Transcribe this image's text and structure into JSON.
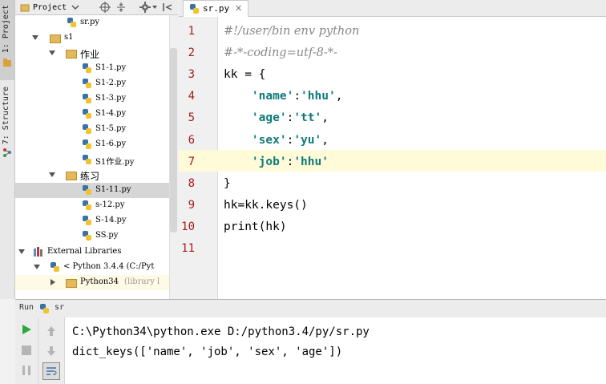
{
  "side_tabs": {
    "project": "1: Project",
    "structure": "7: Structure"
  },
  "project_panel": {
    "title": "Project"
  },
  "tree": [
    {
      "label": "sr.py",
      "type": "py"
    },
    {
      "label": "s1",
      "type": "folder",
      "expanded": true
    },
    {
      "label": "作业",
      "type": "folder",
      "expanded": true
    },
    {
      "label": "S1-1.py",
      "type": "py"
    },
    {
      "label": "S1-2.py",
      "type": "py"
    },
    {
      "label": "S1-3.py",
      "type": "py"
    },
    {
      "label": "S1-4.py",
      "type": "py"
    },
    {
      "label": "S1-5.py",
      "type": "py"
    },
    {
      "label": "S1-6.py",
      "type": "py"
    },
    {
      "label": "S1作业.py",
      "type": "py"
    },
    {
      "label": "练习",
      "type": "folder",
      "expanded": true
    },
    {
      "label": "S1-11.py",
      "type": "py",
      "selected": true
    },
    {
      "label": "s-12.py",
      "type": "py"
    },
    {
      "label": "S-14.py",
      "type": "py"
    },
    {
      "label": "SS.py",
      "type": "py"
    },
    {
      "label": "External Libraries",
      "type": "library",
      "expanded": true
    },
    {
      "label": "< Python 3.4.4 (C:/Pyt",
      "type": "python",
      "expanded": true
    },
    {
      "label": "Python34",
      "suffix": "(library l",
      "type": "folder",
      "expanded": false
    }
  ],
  "editor": {
    "tab_label": "sr.py",
    "line_numbers": [
      "1",
      "2",
      "3",
      "4",
      "5",
      "6",
      "7",
      "8",
      "9",
      "10",
      "11"
    ],
    "lines": [
      [
        {
          "t": "#!/user/bin env python",
          "k": "cm"
        }
      ],
      [
        {
          "t": "#-*-coding=utf-8-*-",
          "k": "cm"
        }
      ],
      [
        {
          "t": "kk = {",
          "k": ""
        }
      ],
      [
        {
          "t": "    ",
          "k": ""
        },
        {
          "t": "'name'",
          "k": "st"
        },
        {
          "t": ":",
          "k": ""
        },
        {
          "t": "'hhu'",
          "k": "st"
        },
        {
          "t": ",",
          "k": ""
        }
      ],
      [
        {
          "t": "    ",
          "k": ""
        },
        {
          "t": "'age'",
          "k": "st"
        },
        {
          "t": ":",
          "k": ""
        },
        {
          "t": "'tt'",
          "k": "st"
        },
        {
          "t": ",",
          "k": ""
        }
      ],
      [
        {
          "t": "    ",
          "k": ""
        },
        {
          "t": "'sex'",
          "k": "st"
        },
        {
          "t": ":",
          "k": ""
        },
        {
          "t": "'yu'",
          "k": "st"
        },
        {
          "t": ",",
          "k": ""
        }
      ],
      [
        {
          "t": "    ",
          "k": ""
        },
        {
          "t": "'job'",
          "k": "st"
        },
        {
          "t": ":",
          "k": ""
        },
        {
          "t": "'hhu'",
          "k": "st"
        }
      ],
      [
        {
          "t": "}",
          "k": ""
        }
      ],
      [
        {
          "t": "hk=kk.keys()",
          "k": ""
        }
      ],
      [
        {
          "t": "print(hk)",
          "k": ""
        }
      ],
      [
        {
          "t": "",
          "k": ""
        }
      ]
    ],
    "current_line": 7
  },
  "run": {
    "label": "Run",
    "config": "sr",
    "output": [
      "C:\\Python34\\python.exe D:/python3.4/py/sr.py",
      "dict_keys(['name', 'job', 'sex', 'age'])"
    ]
  },
  "colors": {
    "comment": "#888888",
    "string": "#0f7a7a",
    "line_number": "#a51e1e",
    "current_line_bg": "#fffbd9"
  }
}
